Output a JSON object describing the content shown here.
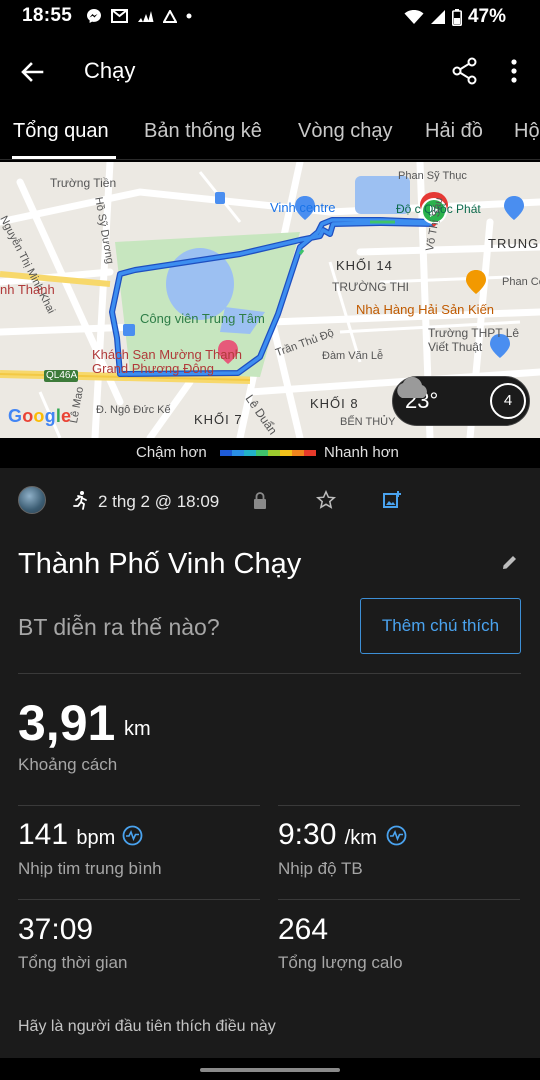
{
  "status_bar": {
    "time": "18:55",
    "battery": "47%"
  },
  "app_bar": {
    "title": "Chạy"
  },
  "tabs": [
    {
      "label": "Tổng quan",
      "active": true
    },
    {
      "label": "Bản thống kê",
      "active": false
    },
    {
      "label": "Vòng chạy",
      "active": false
    },
    {
      "label": "Hải đồ",
      "active": false
    },
    {
      "label": "Hộ",
      "active": false
    }
  ],
  "map": {
    "labels": {
      "truong_tien": "Trường Tiền",
      "nguyen_thi_minh_khai": "Nguyễn Thị Minh Khai",
      "ho_sy_duong": "Hồ Sỹ Dương",
      "vinh_centre": "Vinh centre",
      "doc_quoc_phat": "Độ c Quốc Phát",
      "phan_sy_thuc": "Phan Sỹ Thục",
      "trung": "TRUNG",
      "khoi_14": "KHỐI 14",
      "truong_thi": "TRƯỜNG THI",
      "vo_thi_sau": "Võ Thị Sáu",
      "nha_hang": "Nhà Hàng Hải Sản Kiến",
      "phan_co": "Phan Cô",
      "cong_vien": "Công viên Trung Tâm",
      "khach_san": "Khách Sạn Mường Thanh Grand Phương Đông",
      "ql46a": "QL46A",
      "tran_thu_do": "Trần Thủ Độ",
      "dam_van_le": "Đàm Văn Lễ",
      "truong_thpt": "Trường THPT Lê Viết Thuật",
      "le_mao": "Lê Mao",
      "ngo_duc_ke": "Đ. Ngô Đức Kế",
      "khoi_7": "KHỐI 7",
      "le_duan": "Lê Duẩn",
      "khoi_8": "KHỐI 8",
      "ben_thuy": "BẾN THỦY",
      "google": "Google",
      "nh_thanh": "nh Thanh"
    },
    "weather": {
      "temperature": "23°",
      "wind": "4"
    }
  },
  "legend": {
    "slower": "Chậm hơn",
    "faster": "Nhanh hơn",
    "colors": [
      "#1e5bd8",
      "#2a8fe6",
      "#22b2c9",
      "#3fc36b",
      "#9ccb2f",
      "#f2c21b",
      "#f0851d",
      "#e63a2a"
    ]
  },
  "activity": {
    "date": "2 thg 2 @ 18:09",
    "title": "Thành Phố Vinh Chạy",
    "prompt": "BT diễn ra thế nào?",
    "add_note": "Thêm chú thích",
    "distance": {
      "value": "3,91",
      "unit": "km",
      "label": "Khoảng cách"
    },
    "heart_rate": {
      "value": "141",
      "unit": "bpm",
      "label": "Nhịp tim trung bình"
    },
    "pace": {
      "value": "9:30",
      "unit": "/km",
      "label": "Nhịp độ TB"
    },
    "time": {
      "value": "37:09",
      "label": "Tổng thời gian"
    },
    "calories": {
      "value": "264",
      "label": "Tổng lượng calo"
    },
    "likes": "Hãy là người đầu tiên thích điều này"
  },
  "colors": {
    "accent": "#4aa3ef",
    "route": "#3d8ef0",
    "background": "#1b1b1b"
  }
}
